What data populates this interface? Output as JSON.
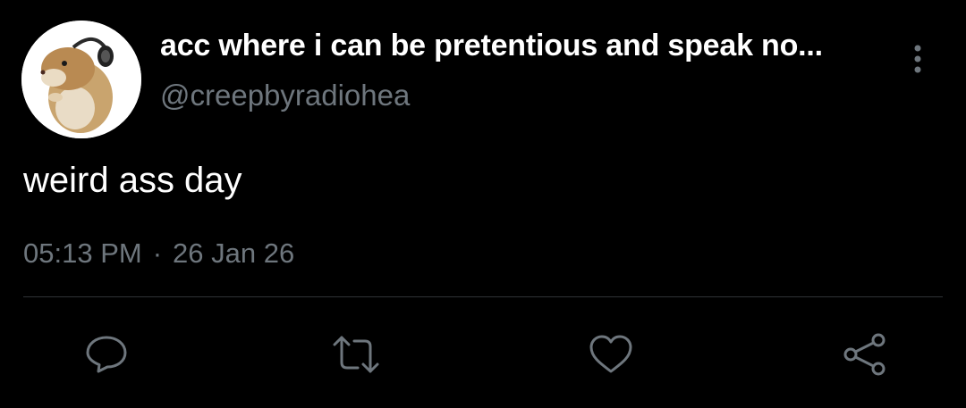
{
  "tweet": {
    "author": {
      "display_name": "acc where i can be pretentious and speak no...",
      "handle": "@creepbyradiohea",
      "avatar_icon": "hamster-with-headphones-avatar"
    },
    "text": "weird ass day",
    "time": "05:13 PM",
    "separator": "·",
    "date": "26 Jan 26",
    "more_icon": "more-vertical-icon",
    "actions": [
      {
        "icon": "reply-icon"
      },
      {
        "icon": "retweet-icon"
      },
      {
        "icon": "like-icon"
      },
      {
        "icon": "share-icon"
      }
    ]
  },
  "colors": {
    "background": "#000000",
    "text_primary": "#ffffff",
    "text_secondary": "#6e767d",
    "divider": "#2f3336"
  }
}
